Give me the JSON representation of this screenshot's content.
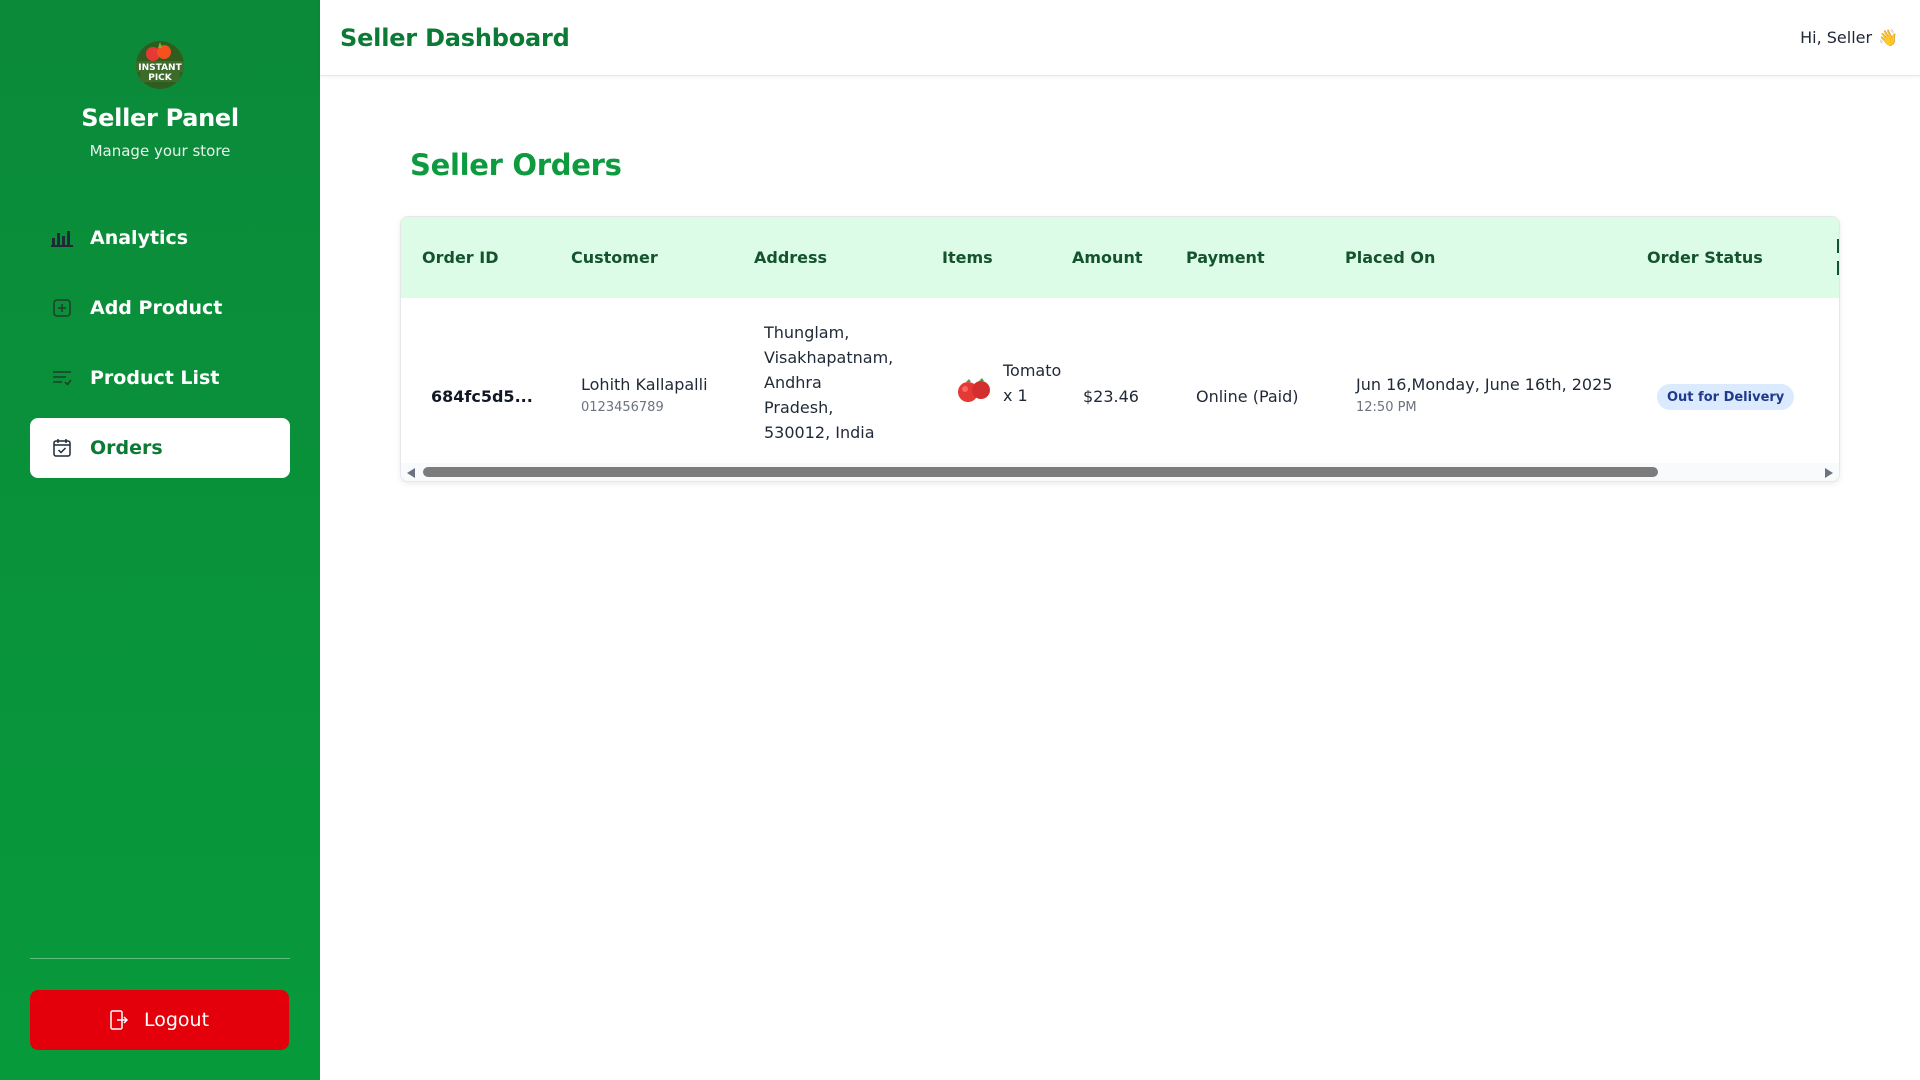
{
  "sidebar": {
    "logo_text_top": "INSTANT",
    "logo_text_bottom": "PICK",
    "title": "Seller Panel",
    "subtitle": "Manage your store",
    "items": [
      {
        "label": "Analytics",
        "icon": "bar-chart-icon",
        "active": false
      },
      {
        "label": "Add Product",
        "icon": "add-square-icon",
        "active": false
      },
      {
        "label": "Product List",
        "icon": "list-icon",
        "active": false
      },
      {
        "label": "Orders",
        "icon": "calendar-check-icon",
        "active": true
      }
    ],
    "logout_label": "Logout"
  },
  "header": {
    "title": "Seller Dashboard",
    "greeting": "Hi, Seller",
    "greeting_emoji": "👋"
  },
  "main": {
    "title": "Seller Orders",
    "table": {
      "columns": [
        "Order ID",
        "Customer",
        "Address",
        "Items",
        "Amount",
        "Payment",
        "Placed On",
        "Order Status"
      ],
      "rows": [
        {
          "order_id": "684fc5d5...",
          "customer_name": "Lohith Kallapalli",
          "customer_phone": "0123456789",
          "address_lines": [
            "Thunglam,",
            "Visakhapatnam,",
            "Andhra",
            "Pradesh,",
            "530012, India"
          ],
          "item_name": "Tomato",
          "item_qty": "x 1",
          "amount": "$23.46",
          "payment": "Online (Paid)",
          "placed_date": "Jun 16,Monday, June 16th, 2025",
          "placed_time": "12:50 PM",
          "status": "Out for Delivery"
        }
      ]
    }
  },
  "colors": {
    "sidebar_green": "#0b8a3a",
    "accent_green": "#0e9a3e",
    "header_row_bg": "#dcfce7",
    "logout_red": "#e3000b",
    "status_badge_bg": "#dbeafe",
    "status_badge_text": "#1e3a8a"
  }
}
